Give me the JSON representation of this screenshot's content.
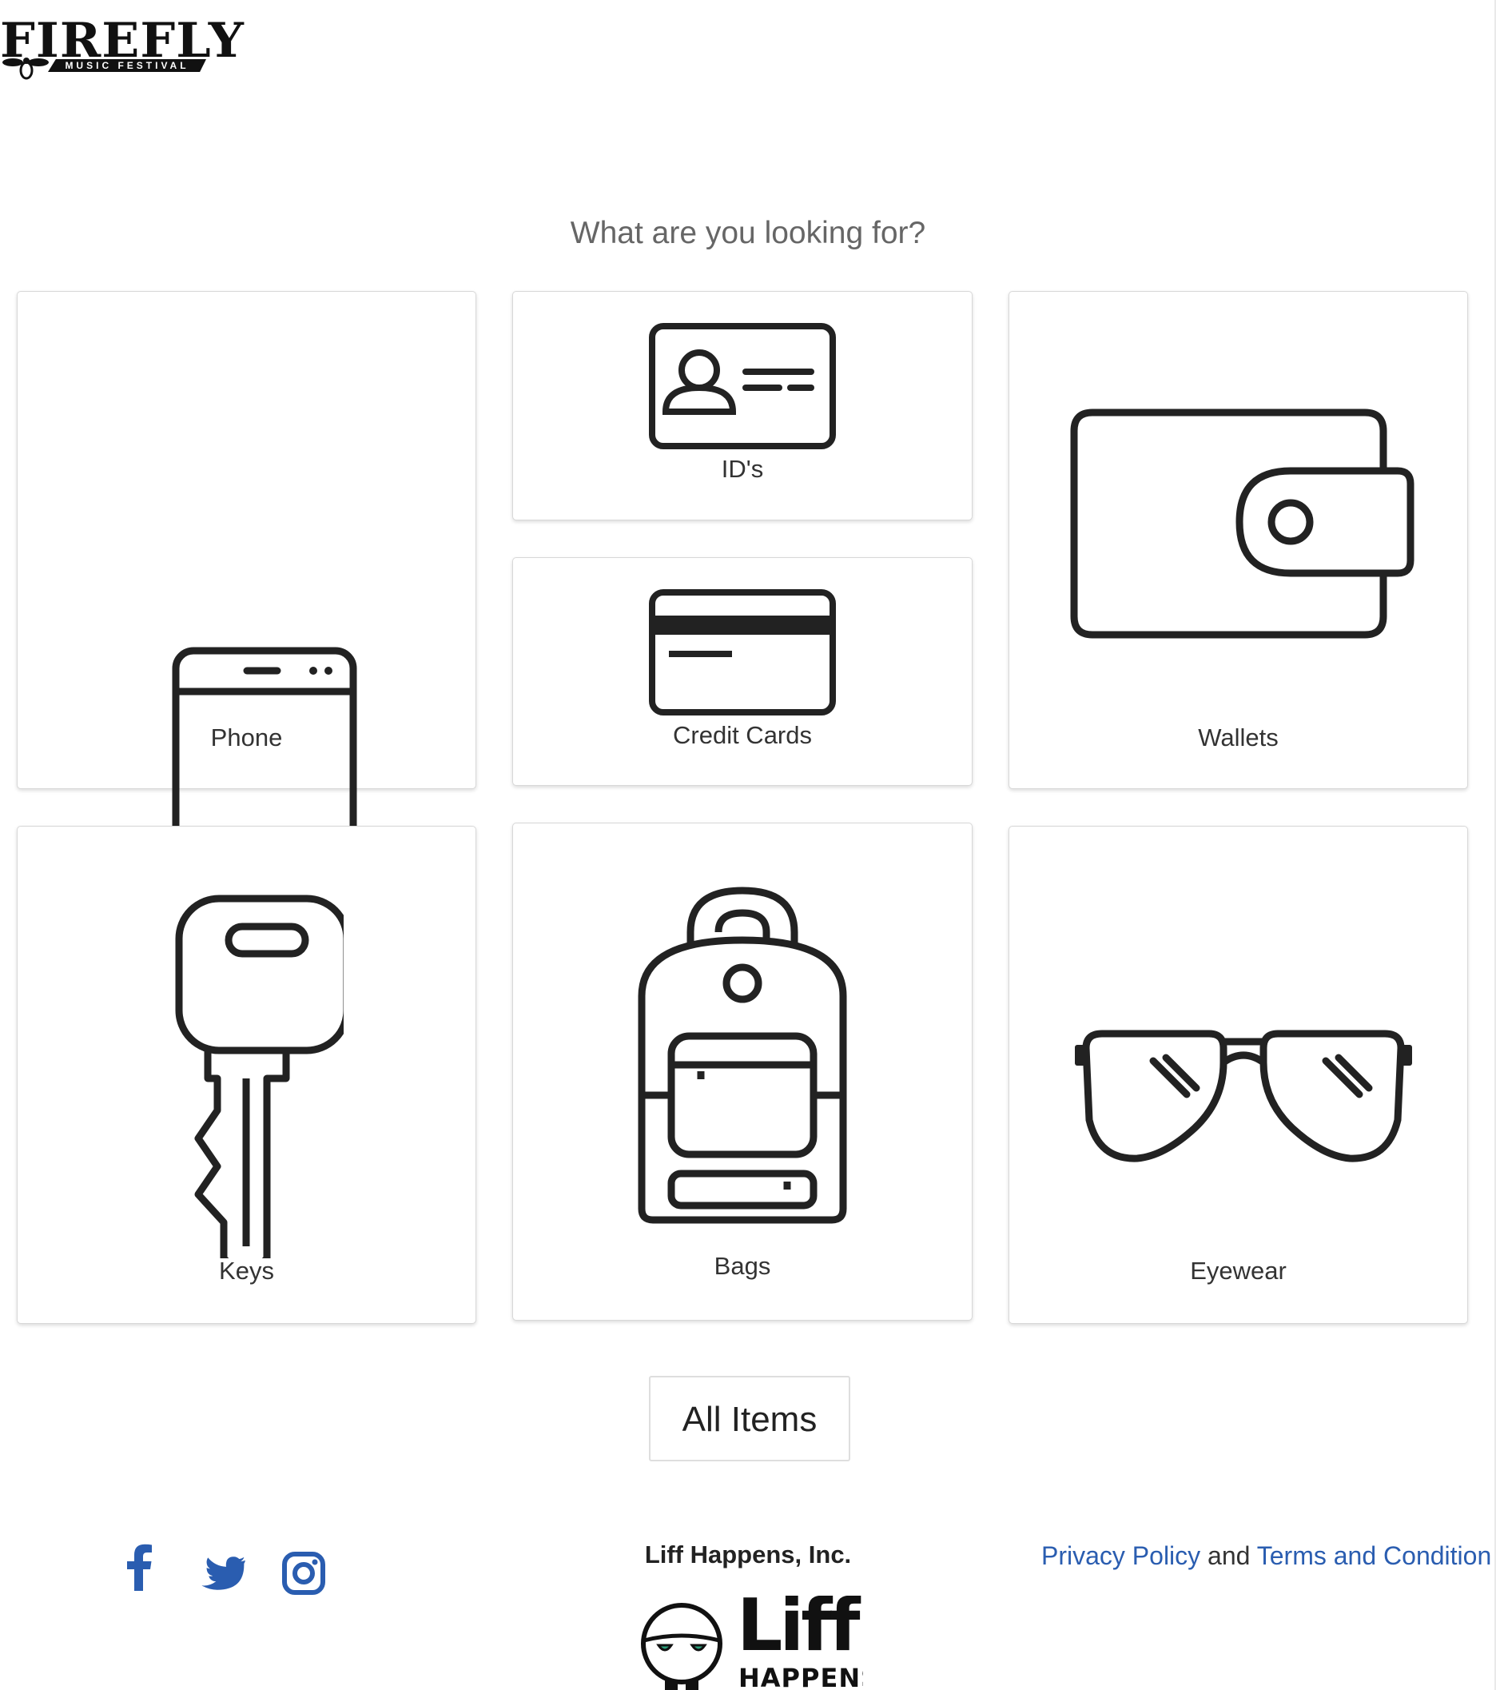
{
  "header": {
    "logo_title": "FIREFLY",
    "logo_subtitle": "MUSIC FESTIVAL"
  },
  "main": {
    "prompt": "What are you looking for?",
    "categories": [
      {
        "label": "Phone",
        "icon": "phone-icon"
      },
      {
        "label": "ID's",
        "icon": "id-card-icon"
      },
      {
        "label": "Credit Cards",
        "icon": "credit-card-icon"
      },
      {
        "label": "Wallets",
        "icon": "wallet-icon"
      },
      {
        "label": "Keys",
        "icon": "key-icon"
      },
      {
        "label": "Bags",
        "icon": "backpack-icon"
      },
      {
        "label": "Eyewear",
        "icon": "sunglasses-icon"
      }
    ],
    "all_items_label": "All Items"
  },
  "footer": {
    "social": [
      {
        "name": "facebook-icon"
      },
      {
        "name": "twitter-icon"
      },
      {
        "name": "instagram-icon"
      }
    ],
    "company_name": "Liff Happens, Inc.",
    "company_logo_word": "Liff",
    "company_logo_sub": "HAPPENS",
    "privacy_label": "Privacy Policy",
    "and_text": " and ",
    "terms_label": "Terms and Condition"
  },
  "colors": {
    "link": "#2a5db0",
    "social": "#2a5db0",
    "icon_stroke": "#222222"
  }
}
